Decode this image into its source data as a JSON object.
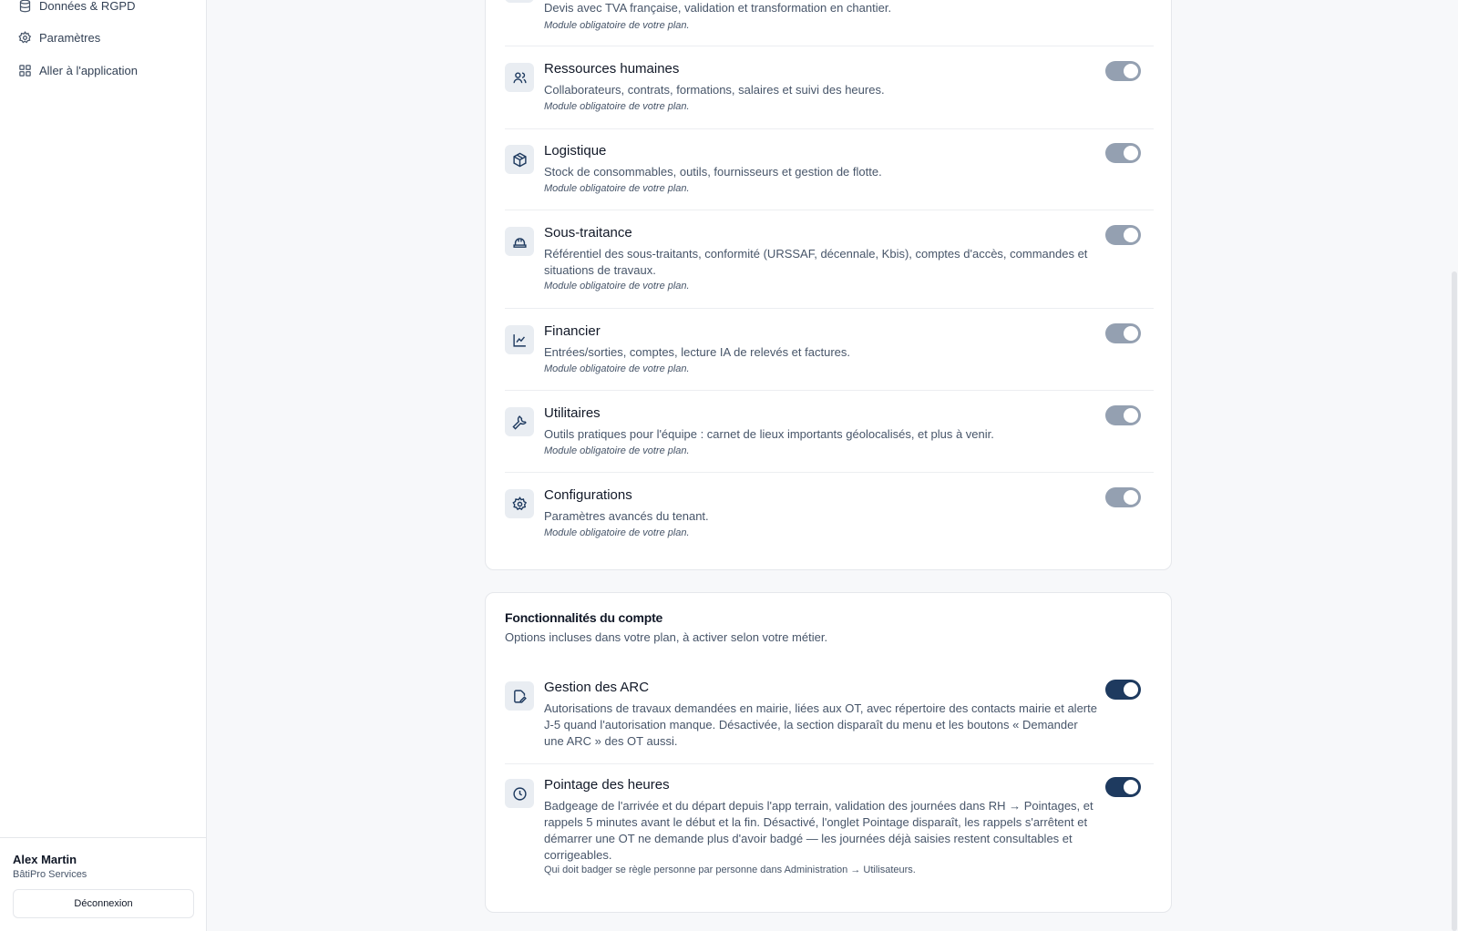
{
  "sidebar": {
    "items": [
      {
        "label": "Données & RGPD",
        "icon": "database-icon"
      },
      {
        "label": "Paramètres",
        "icon": "gear-icon"
      },
      {
        "label": "Aller à l'application",
        "icon": "grid-icon"
      }
    ],
    "user": {
      "name": "Alex Martin",
      "company": "BâtiPro Services"
    },
    "logout_label": "Déconnexion"
  },
  "modules": {
    "top_partial": {
      "desc": "Devis avec TVA française, validation et transformation en chantier.",
      "note": "Module obligatoire de votre plan."
    },
    "items": [
      {
        "title": "Ressources humaines",
        "desc": "Collaborateurs, contrats, formations, salaires et suivi des heures.",
        "note": "Module obligatoire de votre plan.",
        "icon": "users-icon",
        "enabled": true
      },
      {
        "title": "Logistique",
        "desc": "Stock de consommables, outils, fournisseurs et gestion de flotte.",
        "note": "Module obligatoire de votre plan.",
        "icon": "package-icon",
        "enabled": true
      },
      {
        "title": "Sous-traitance",
        "desc": "Référentiel des sous-traitants, conformité (URSSAF, décennale, Kbis), comptes d'accès, commandes et situations de travaux.",
        "note": "Module obligatoire de votre plan.",
        "icon": "hard-hat-icon",
        "enabled": true
      },
      {
        "title": "Financier",
        "desc": "Entrées/sorties, comptes, lecture IA de relevés et factures.",
        "note": "Module obligatoire de votre plan.",
        "icon": "line-chart-icon",
        "enabled": true
      },
      {
        "title": "Utilitaires",
        "desc": "Outils pratiques pour l'équipe : carnet de lieux importants géolocalisés, et plus à venir.",
        "note": "Module obligatoire de votre plan.",
        "icon": "wrench-icon",
        "enabled": true
      },
      {
        "title": "Configurations",
        "desc": "Paramètres avancés du tenant.",
        "note": "Module obligatoire de votre plan.",
        "icon": "gear-icon",
        "enabled": true
      }
    ]
  },
  "features": {
    "title": "Fonctionnalités du compte",
    "subtitle": "Options incluses dans votre plan, à activer selon votre métier.",
    "items": [
      {
        "title": "Gestion des ARC",
        "desc": "Autorisations de travaux demandées en mairie, liées aux OT, avec répertoire des contacts mairie et alerte J-5 quand l'autorisation manque. Désactivée, la section disparaît du menu et les boutons « Demander une ARC » des OT aussi.",
        "icon": "file-edit-icon",
        "enabled": true
      },
      {
        "title": "Pointage des heures",
        "desc": "Badgeage de l'arrivée et du départ depuis l'app terrain, validation des journées dans RH → Pointages, et rappels 5 minutes avant le début et la fin. Désactivé, l'onglet Pointage disparaît, les rappels s'arrêtent et démarrer une OT ne demande plus d'avoir badgé — les journées déjà saisies restent consultables et corrigeables.",
        "note": "Qui doit badger se règle personne par personne dans Administration → Utilisateurs.",
        "icon": "clock-icon",
        "enabled": true
      }
    ]
  },
  "colors": {
    "toggle_on": "#1e3a5f",
    "toggle_locked": "#94a0b1",
    "icon_bg": "#e9edf2"
  }
}
